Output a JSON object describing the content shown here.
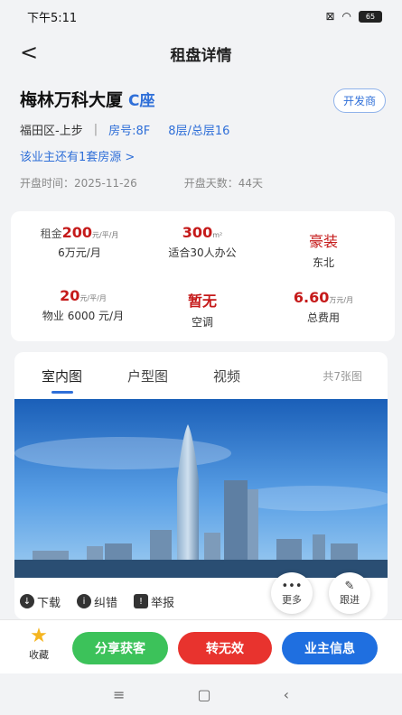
{
  "status": {
    "time": "下午5:11",
    "battery": "65"
  },
  "nav": {
    "back_glyph": "<",
    "title": "租盘详情"
  },
  "header": {
    "name": "梅林万科大厦",
    "tag": "C座",
    "dev_button": "开发商",
    "district": "福田区-上步",
    "separator": "|",
    "room": "房号:8F",
    "floor": "8层/总层16",
    "owner_link": "该业主还有1套房源 >",
    "open_time": "开盘时间：2025-11-26",
    "open_days": "开盘天数：44天"
  },
  "stats": {
    "rent": {
      "prefix": "租金",
      "value": "200",
      "unit": "元/平/月",
      "sub": "6万元/月"
    },
    "area": {
      "value": "300",
      "unit": "m²",
      "sub": "适合30人办公"
    },
    "decor": {
      "value": "豪装",
      "sub": "东北"
    },
    "property_fee": {
      "value": "20",
      "unit": "元/平/月",
      "sub": "物业 6000 元/月"
    },
    "ac": {
      "value": "暂无",
      "sub": "空调"
    },
    "total": {
      "value": "6.60",
      "unit": "万元/月",
      "sub": "总费用"
    }
  },
  "media": {
    "tabs": [
      "室内图",
      "户型图",
      "视频"
    ],
    "count": "共7张图",
    "actions": {
      "download": "下载",
      "correct": "纠错",
      "report": "举报"
    },
    "more": "更多",
    "follow": "跟进"
  },
  "bottom": {
    "favorite": "收藏",
    "share": "分享获客",
    "invalid": "转无效",
    "owner_info": "业主信息"
  },
  "colors": {
    "accent": "#2f6fd8",
    "price": "#c51a1a",
    "share": "#3cc25a",
    "invalid": "#e8332e",
    "owner": "#1f6fe0"
  }
}
